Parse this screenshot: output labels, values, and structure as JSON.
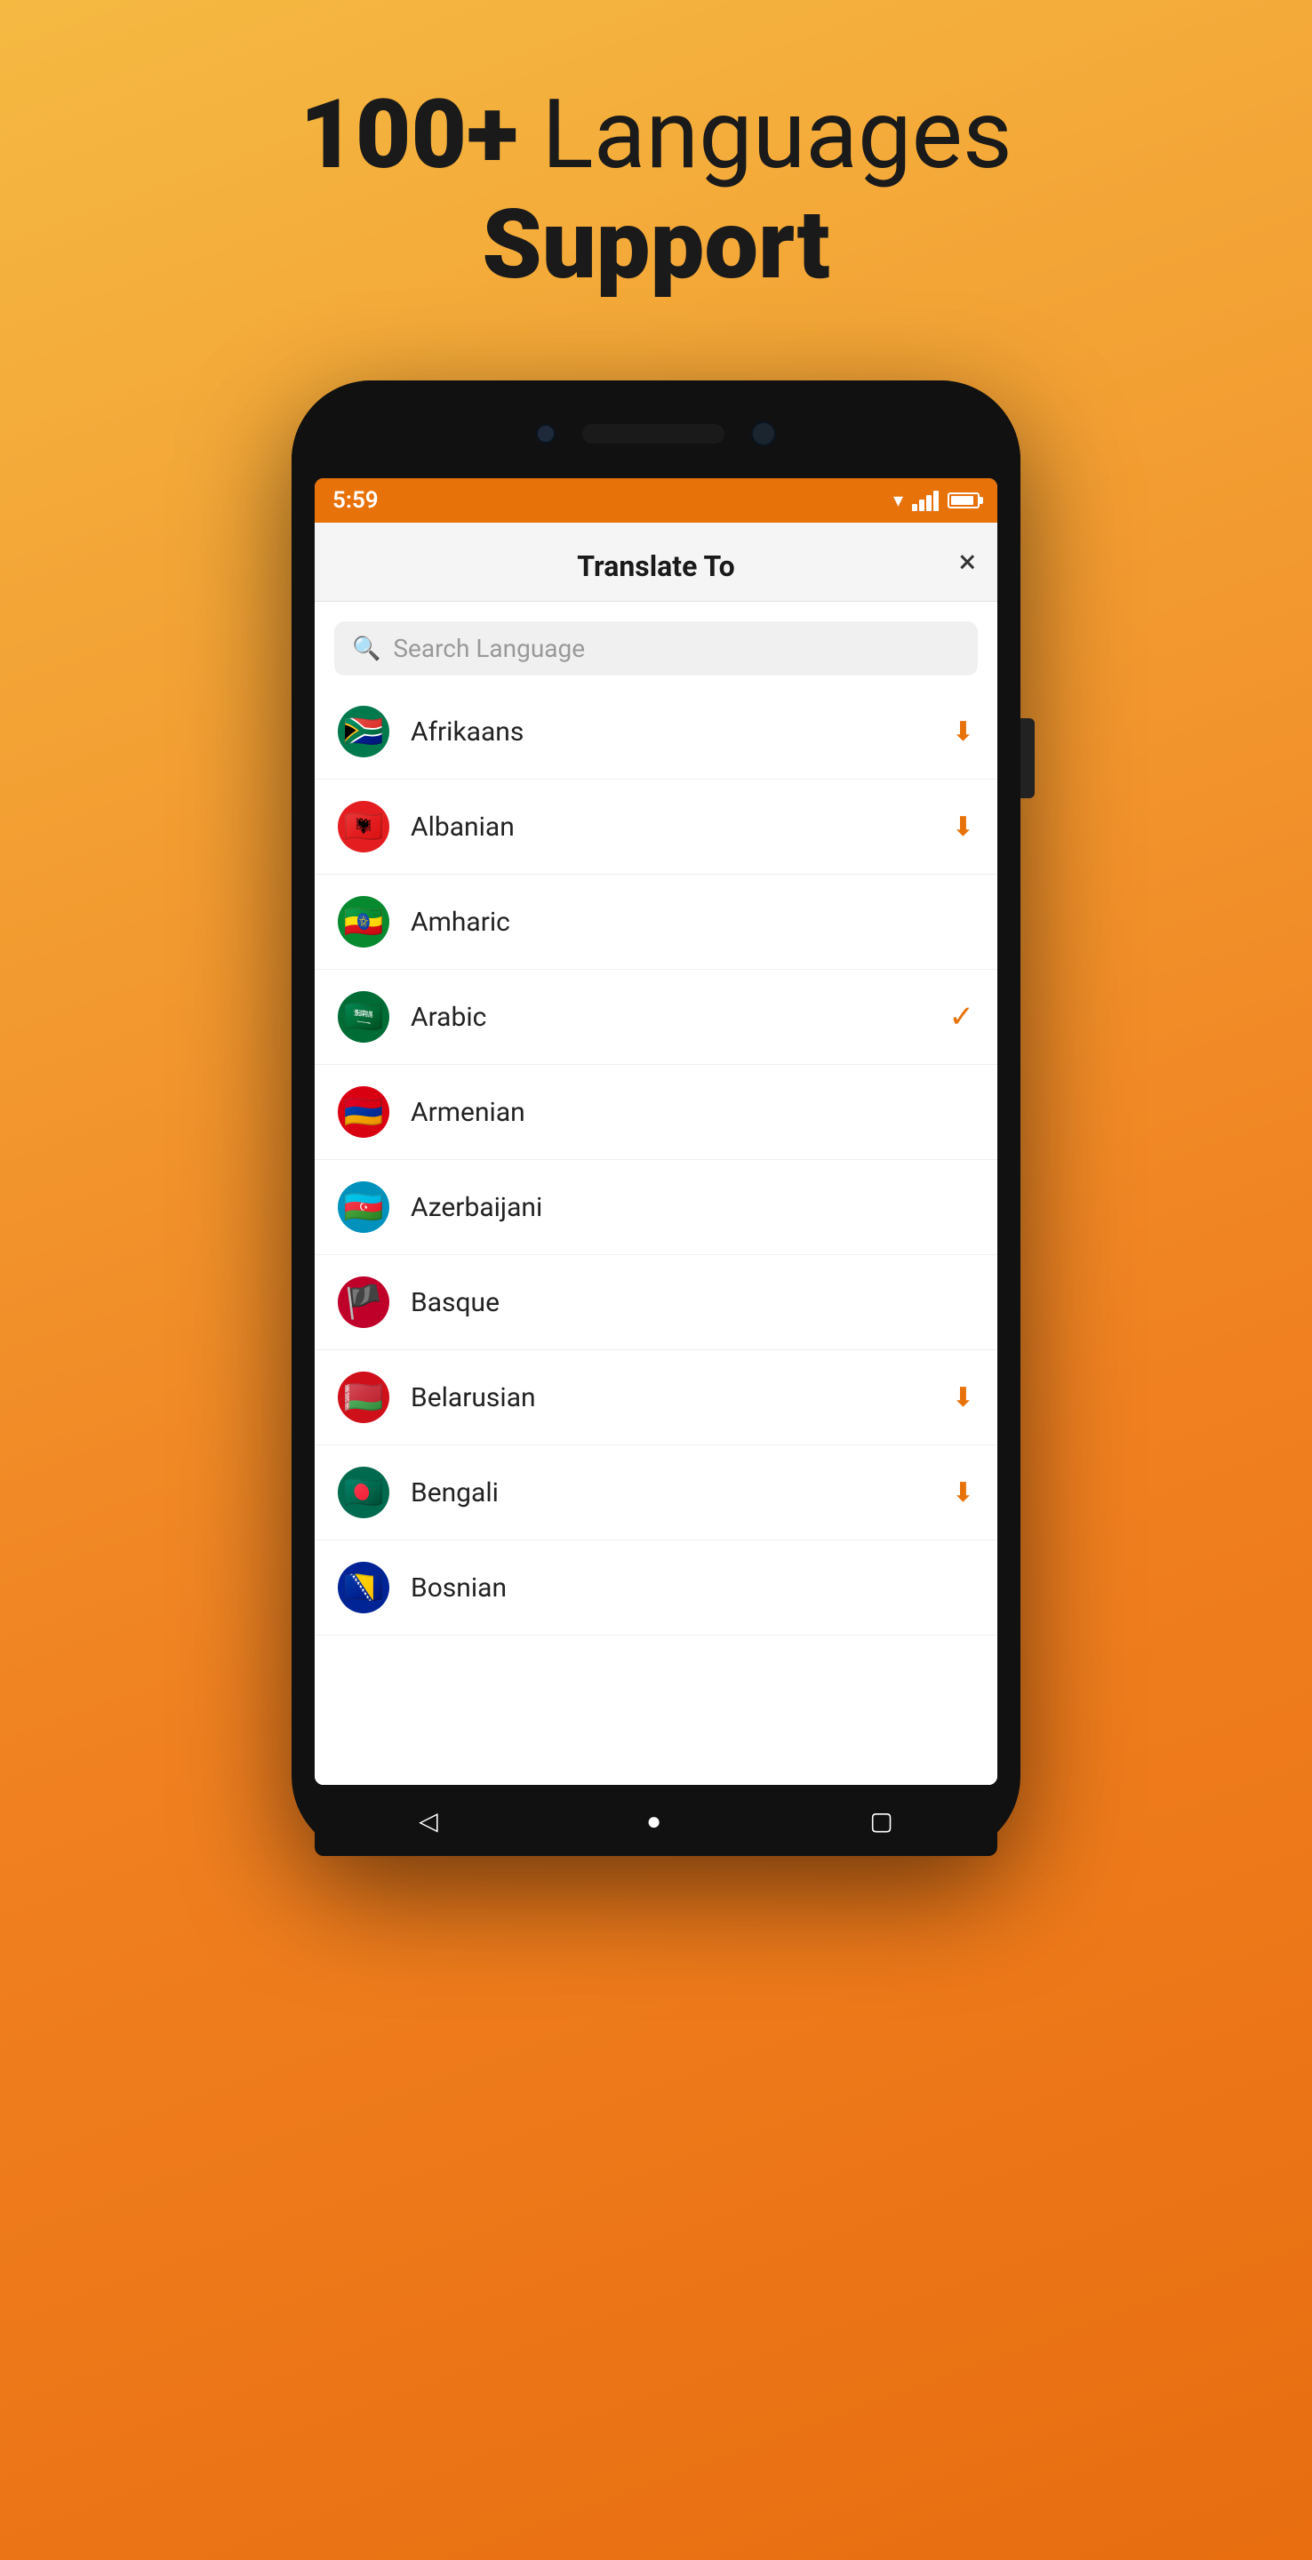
{
  "headline": {
    "line1_bold": "100+",
    "line1_normal": " Languages",
    "line2": "Support"
  },
  "status_bar": {
    "time": "5:59",
    "accent_color": "#e8720a"
  },
  "sheet": {
    "title": "Translate To",
    "close_label": "×",
    "search_placeholder": "Search Language"
  },
  "languages": [
    {
      "name": "Afrikaans",
      "flag_emoji": "🇿🇦",
      "flag_class": "flag-za",
      "action": "download"
    },
    {
      "name": "Albanian",
      "flag_emoji": "🇦🇱",
      "flag_class": "flag-al",
      "action": "download"
    },
    {
      "name": "Amharic",
      "flag_emoji": "🇪🇹",
      "flag_class": "flag-et",
      "action": "none"
    },
    {
      "name": "Arabic",
      "flag_emoji": "🇸🇦",
      "flag_class": "flag-sa",
      "action": "check"
    },
    {
      "name": "Armenian",
      "flag_emoji": "🇦🇲",
      "flag_class": "flag-am",
      "action": "none"
    },
    {
      "name": "Azerbaijani",
      "flag_emoji": "🇦🇿",
      "flag_class": "flag-az",
      "action": "none"
    },
    {
      "name": "Basque",
      "flag_emoji": "🏴",
      "flag_class": "flag-eu",
      "action": "none"
    },
    {
      "name": "Belarusian",
      "flag_emoji": "🇧🇾",
      "flag_class": "flag-by",
      "action": "download"
    },
    {
      "name": "Bengali",
      "flag_emoji": "🇧🇩",
      "flag_class": "flag-bd",
      "action": "download"
    },
    {
      "name": "Bosnian",
      "flag_emoji": "🇧🇦",
      "flag_class": "flag-ba",
      "action": "none"
    }
  ],
  "bottom_nav": {
    "back": "◁",
    "home": "●",
    "recent": "▢"
  }
}
